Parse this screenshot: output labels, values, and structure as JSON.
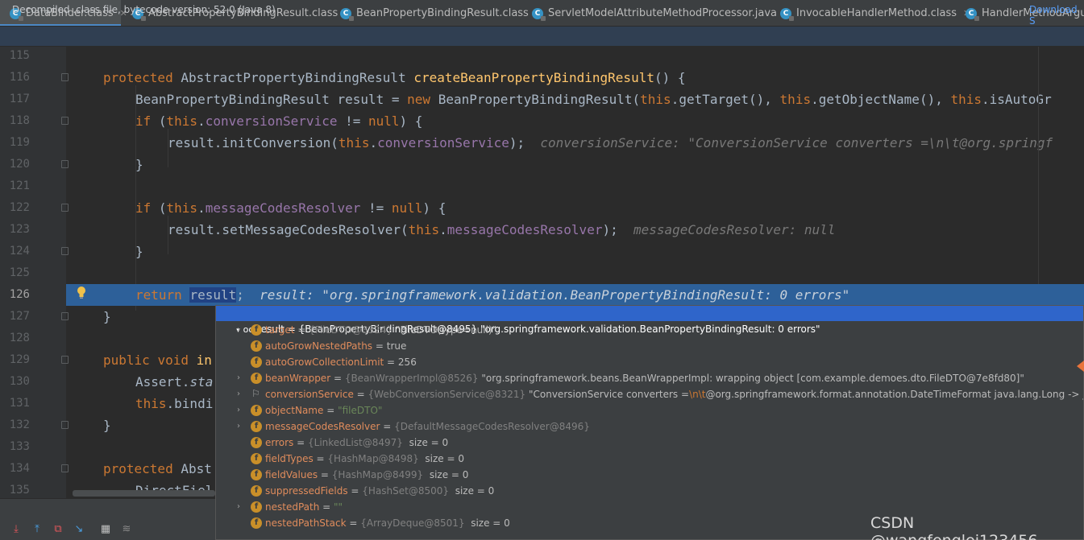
{
  "tabs": [
    {
      "label": "DataBinder.class",
      "icon": "class-icon",
      "active": true
    },
    {
      "label": "AbstractPropertyBindingResult.class",
      "icon": "class-icon",
      "active": false
    },
    {
      "label": "BeanPropertyBindingResult.class",
      "icon": "class-icon",
      "active": false
    },
    {
      "label": "ServletModelAttributeMethodProcessor.java",
      "icon": "class-icon",
      "active": false
    },
    {
      "label": "InvocableHandlerMethod.class",
      "icon": "class-icon",
      "active": false
    },
    {
      "label": "HandlerMethodArgume",
      "icon": "class-icon",
      "active": false
    }
  ],
  "banner": {
    "text": "Decompiled .class file, bytecode version: 52.0 (Java 8)",
    "link": "Download S"
  },
  "gutter": {
    "line_numbers": [
      "115",
      "116",
      "117",
      "118",
      "119",
      "120",
      "121",
      "122",
      "123",
      "124",
      "125",
      "126",
      "127",
      "128",
      "129",
      "130",
      "131",
      "132",
      "133",
      "134",
      "135"
    ],
    "current_line": "126"
  },
  "code": {
    "l116": {
      "kw": "protected",
      "type": "AbstractPropertyBindingResult",
      "fn": "createBeanPropertyBindingResult",
      "rest": "() {"
    },
    "l117": {
      "a": "BeanPropertyBindingResult result = ",
      "kw1": "new",
      "b": " BeanPropertyBindingResult(",
      "this1": "this",
      "c": ".getTarget(), ",
      "this2": "this",
      "d": ".getObjectName(), ",
      "this3": "this",
      "e": ".isAutoGr"
    },
    "l118": {
      "kw": "if",
      "a": " (",
      "this": "this",
      "dot": ".",
      "fld": "conversionService",
      "b": " != ",
      "null": "null",
      "c": ") {"
    },
    "l119": {
      "a": "result.initConversion(",
      "this": "this",
      "dot": ".",
      "fld": "conversionService",
      "b": ");",
      "hint": "conversionService: \"ConversionService converters =\\n\\t@org.springf"
    },
    "l120": {
      "a": "}"
    },
    "l122": {
      "kw": "if",
      "a": " (",
      "this": "this",
      "dot": ".",
      "fld": "messageCodesResolver",
      "b": " != ",
      "null": "null",
      "c": ") {"
    },
    "l123": {
      "a": "result.setMessageCodesResolver(",
      "this": "this",
      "dot": ".",
      "fld": "messageCodesResolver",
      "b": ");",
      "hint": "messageCodesResolver: null"
    },
    "l124": {
      "a": "}"
    },
    "l126": {
      "kw": "return",
      "sel": "result",
      "semi": ";",
      "hint": "result: \"org.springframework.validation.BeanPropertyBindingResult: 0 errors\""
    },
    "l127": {
      "a": "}"
    },
    "l129": {
      "kw1": "public",
      "kw2": "void",
      "frag": "in"
    },
    "l130": {
      "a": "Assert.",
      "b": "sta"
    },
    "l131": {
      "this": "this",
      "a": ".bindi"
    },
    "l132": {
      "a": "}"
    },
    "l134": {
      "kw": "protected",
      "a": "Abst"
    },
    "l135": {
      "a": "DirectFiel"
    }
  },
  "debugger": {
    "header": {
      "name": "result",
      "value": " = {BeanPropertyBindingResult@8495} \"org.springframework.validation.BeanPropertyBindingResult: 0 errors\""
    },
    "fields": [
      {
        "name": "target",
        "ref": "{FileDTO@8324}",
        "value": "\"FileDTO(type=null)\"",
        "expandable": true,
        "icon": "field-icon"
      },
      {
        "name": "autoGrowNestedPaths",
        "ref": "",
        "value": "true",
        "expandable": false,
        "icon": "field-icon"
      },
      {
        "name": "autoGrowCollectionLimit",
        "ref": "",
        "value": "256",
        "expandable": false,
        "icon": "field-icon"
      },
      {
        "name": "beanWrapper",
        "ref": "{BeanWrapperImpl@8526}",
        "value": "\"org.springframework.beans.BeanWrapperImpl: wrapping object [com.example.demoes.dto.FileDTO@7e8fd80]\"",
        "expandable": true,
        "icon": "field-icon"
      },
      {
        "name": "conversionService",
        "ref": "{WebConversionService@8321}",
        "value_pre": "\"ConversionService converters =",
        "value_esc": "\\n\\t",
        "value_post": "@org.springframework.format.annotation.DateTimeFormat java.lang.Long -> java.lang.",
        "expandable": true,
        "icon": "flag-icon"
      },
      {
        "name": "objectName",
        "ref": "",
        "value": "\"fileDTO\"",
        "expandable": true,
        "icon": "field-icon"
      },
      {
        "name": "messageCodesResolver",
        "ref": "{DefaultMessageCodesResolver@8496}",
        "value": "",
        "expandable": true,
        "icon": "field-icon"
      },
      {
        "name": "errors",
        "ref": "{LinkedList@8497}",
        "value": "size = 0",
        "expandable": false,
        "icon": "field-icon"
      },
      {
        "name": "fieldTypes",
        "ref": "{HashMap@8498}",
        "value": "size = 0",
        "expandable": false,
        "icon": "field-icon"
      },
      {
        "name": "fieldValues",
        "ref": "{HashMap@8499}",
        "value": "size = 0",
        "expandable": false,
        "icon": "field-icon"
      },
      {
        "name": "suppressedFields",
        "ref": "{HashSet@8500}",
        "value": "size = 0",
        "expandable": false,
        "icon": "field-icon"
      },
      {
        "name": "nestedPath",
        "ref": "",
        "value": "\"\"",
        "expandable": true,
        "icon": "field-icon"
      },
      {
        "name": "nestedPathStack",
        "ref": "{ArrayDeque@8501}",
        "value": "size = 0",
        "expandable": false,
        "icon": "field-icon"
      }
    ]
  },
  "toolbar": {
    "icons": [
      "step-into-icon",
      "step-out-icon",
      "drop-frame-icon",
      "run-to-cursor-icon",
      "evaluate-icon",
      "trace-icon"
    ]
  },
  "watermark": "CSDN @wangfenglei123456",
  "colors": {
    "accent": "#2d6099",
    "popup_header": "#2f65ca",
    "keyword": "#cc7832",
    "field": "#9876aa",
    "function": "#ffc66d"
  }
}
